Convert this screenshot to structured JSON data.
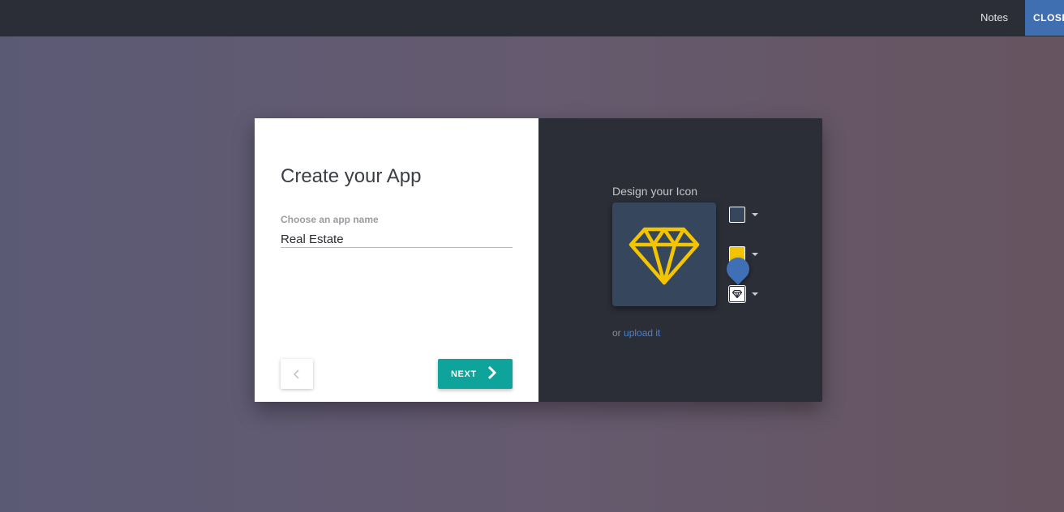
{
  "topbar": {
    "notes_label": "Notes",
    "close_label": "CLOSE"
  },
  "dialog": {
    "title": "Create your App",
    "app_name_label": "Choose an app name",
    "app_name_value": "Real Estate",
    "next_label": "NEXT",
    "design_label": "Design your Icon",
    "upload_prefix": "or",
    "upload_link": "upload it",
    "icon": {
      "glyph": "diamond-icon",
      "background_color": "#36465d",
      "glyph_color": "#f2c500"
    }
  },
  "colors": {
    "topbar": "#2b2e37",
    "close_button": "#3f6fb0",
    "next_button": "#0ea39b",
    "right_pane": "#2b2e37",
    "link": "#4c83c8",
    "pin": "#3f70b6"
  }
}
